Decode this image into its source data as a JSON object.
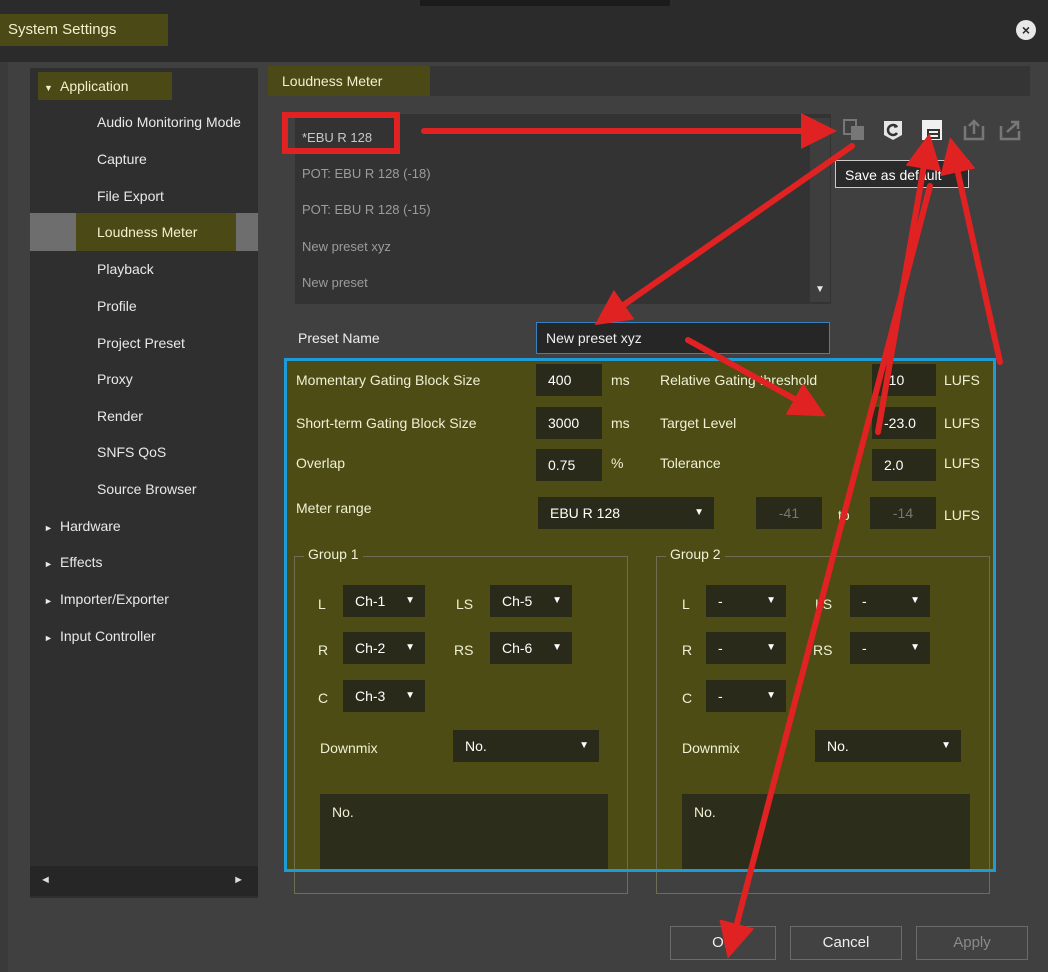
{
  "window": {
    "title": "System Settings"
  },
  "sidebar": {
    "items": [
      {
        "label": "Application",
        "expanded": true
      },
      {
        "label": "Audio Monitoring Mode"
      },
      {
        "label": "Capture"
      },
      {
        "label": "File Export"
      },
      {
        "label": "Loudness Meter",
        "selected": true
      },
      {
        "label": "Playback"
      },
      {
        "label": "Profile"
      },
      {
        "label": "Project Preset"
      },
      {
        "label": "Proxy"
      },
      {
        "label": "Render"
      },
      {
        "label": "SNFS QoS"
      },
      {
        "label": "Source Browser"
      },
      {
        "label": "Hardware",
        "expanded": false
      },
      {
        "label": "Effects",
        "expanded": false
      },
      {
        "label": "Importer/Exporter",
        "expanded": false
      },
      {
        "label": "Input Controller",
        "expanded": false
      }
    ]
  },
  "content": {
    "tab": "Loudness Meter",
    "presets": [
      "*EBU R 128",
      "POT: EBU R 128 (-18)",
      "POT: EBU R 128 (-15)",
      "New preset xyz",
      "New preset"
    ],
    "toolbar": {
      "icons": [
        "copy-preset-icon",
        "reset-preset-icon",
        "save-default-icon",
        "import-preset-icon",
        "export-preset-icon"
      ],
      "tooltip": "Save as default"
    },
    "preset_name": {
      "label": "Preset Name",
      "value": "New preset xyz"
    },
    "params": {
      "momentary": {
        "label": "Momentary Gating Block Size",
        "value": "400",
        "unit": "ms"
      },
      "short_term": {
        "label": "Short-term Gating Block Size",
        "value": "3000",
        "unit": "ms"
      },
      "overlap": {
        "label": "Overlap",
        "value": "0.75",
        "unit": "%"
      },
      "relative": {
        "label": "Relative Gating threshold",
        "value": "-10",
        "unit": "LUFS"
      },
      "target": {
        "label": "Target Level",
        "value": "-23.0",
        "unit": "LUFS"
      },
      "tolerance": {
        "label": "Tolerance",
        "value": "2.0",
        "unit": "LUFS"
      },
      "meter_range": {
        "label": "Meter range",
        "value": "EBU R 128",
        "min": "-41",
        "to": "to",
        "max": "-14",
        "unit": "LUFS"
      }
    },
    "group1": {
      "title": "Group 1",
      "L": {
        "label": "L",
        "value": "Ch-1"
      },
      "LS": {
        "label": "LS",
        "value": "Ch-5"
      },
      "R": {
        "label": "R",
        "value": "Ch-2"
      },
      "RS": {
        "label": "RS",
        "value": "Ch-6"
      },
      "C": {
        "label": "C",
        "value": "Ch-3"
      },
      "downmix": {
        "label": "Downmix",
        "value": "No."
      },
      "note": "No."
    },
    "group2": {
      "title": "Group 2",
      "L": {
        "label": "L",
        "value": "-"
      },
      "LS": {
        "label": "LS",
        "value": "-"
      },
      "R": {
        "label": "R",
        "value": "-"
      },
      "RS": {
        "label": "RS",
        "value": "-"
      },
      "C": {
        "label": "C",
        "value": "-"
      },
      "downmix": {
        "label": "Downmix",
        "value": "No."
      },
      "note": "No."
    }
  },
  "buttons": {
    "ok": "OK",
    "cancel": "Cancel",
    "apply": "Apply"
  },
  "colors": {
    "accent_tab": "#4b4a16",
    "params_bg": "#4c4c14",
    "highlight_border": "#1e9bd7",
    "annotation_red": "#e02222"
  }
}
